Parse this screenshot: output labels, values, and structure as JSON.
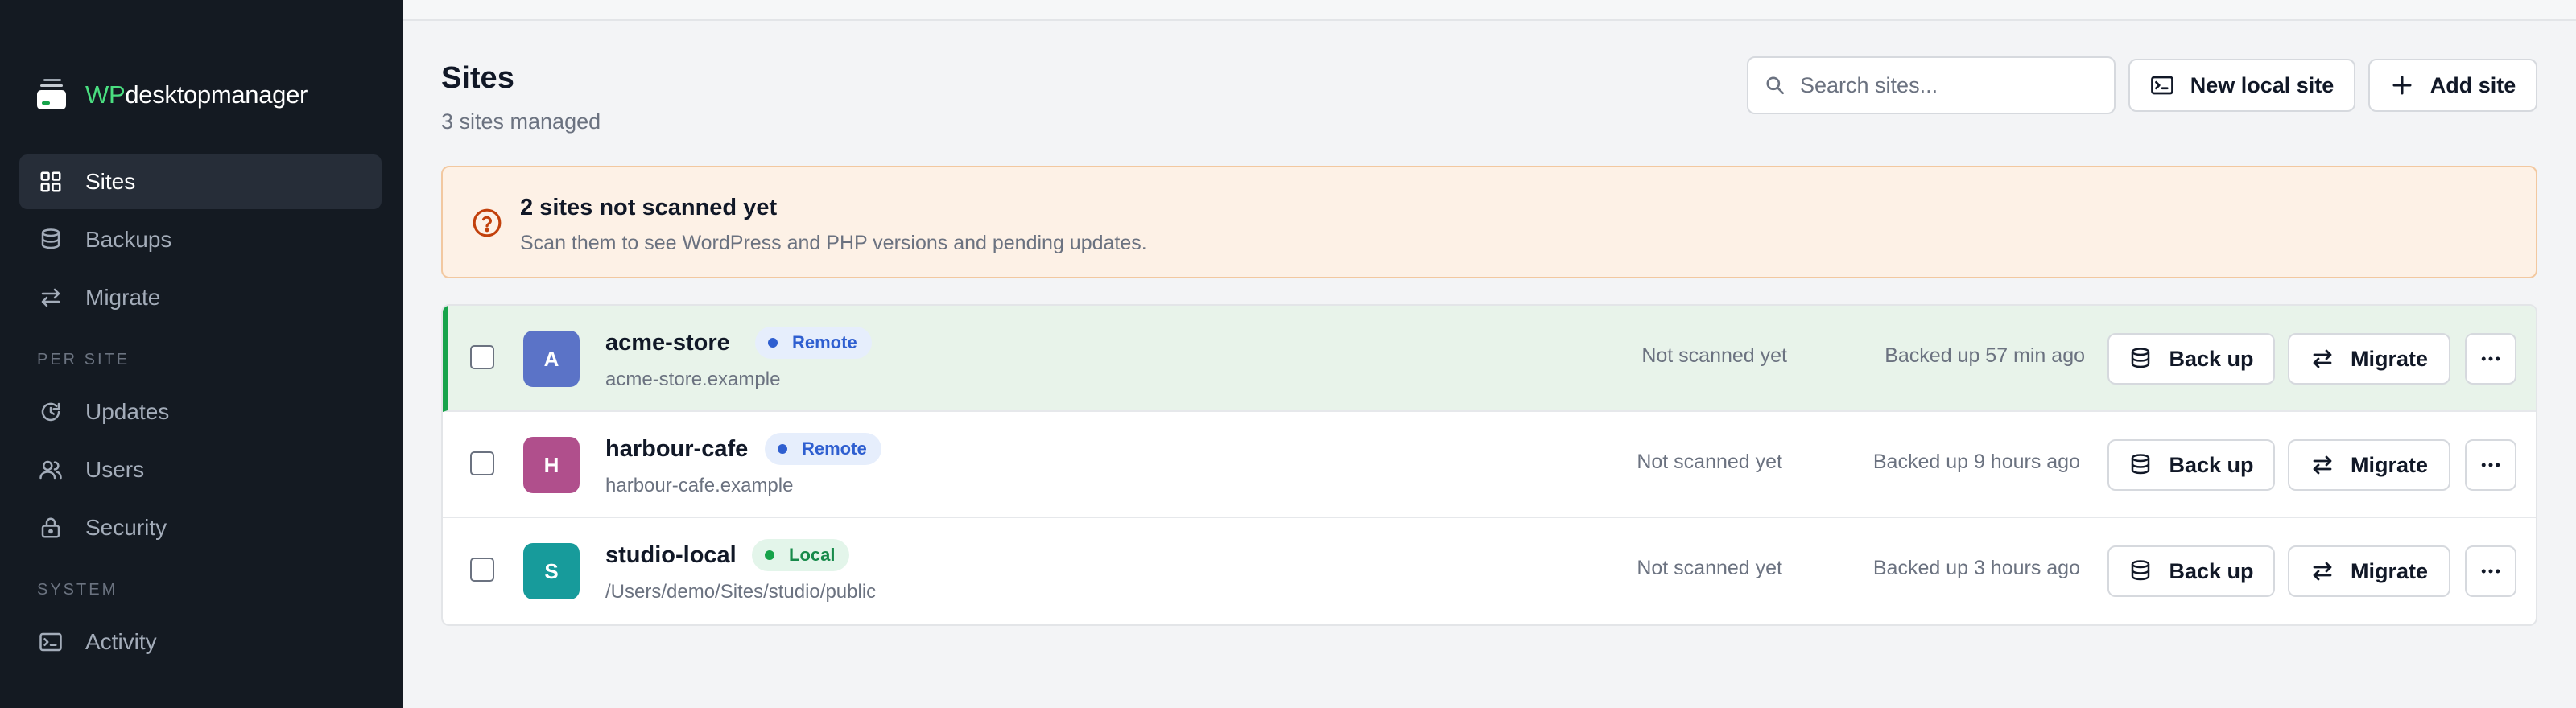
{
  "brand": {
    "prefix": "WP",
    "name": "desktopmanager"
  },
  "sidebar": {
    "items": [
      {
        "label": "Sites",
        "icon": "grid-icon",
        "active": true
      },
      {
        "label": "Backups",
        "icon": "database-icon"
      },
      {
        "label": "Migrate",
        "icon": "arrows-swap-icon"
      }
    ],
    "per_site_label": "PER SITE",
    "per_site_items": [
      {
        "label": "Updates",
        "icon": "refresh-clock-icon"
      },
      {
        "label": "Users",
        "icon": "users-icon"
      },
      {
        "label": "Security",
        "icon": "lock-icon"
      }
    ],
    "system_label": "SYSTEM",
    "system_items": [
      {
        "label": "Activity",
        "icon": "terminal-icon"
      }
    ]
  },
  "header": {
    "title": "Sites",
    "subtitle": "3 sites managed",
    "search_placeholder": "Search sites...",
    "new_local_label": "New local site",
    "add_site_label": "Add site"
  },
  "alert": {
    "title": "2 sites not scanned yet",
    "text": "Scan them to see WordPress and PHP versions and pending updates.",
    "icon": "question-circle-icon"
  },
  "sites": [
    {
      "initial": "A",
      "name": "acme-store",
      "badge": "Remote",
      "url": "acme-store.example",
      "scan": "Not scanned yet",
      "backup": "Backed up 57 min ago",
      "avatar_color": "#5b73c7",
      "highlighted": true
    },
    {
      "initial": "H",
      "name": "harbour-cafe",
      "badge": "Remote",
      "url": "harbour-cafe.example",
      "scan": "Not scanned yet",
      "backup": "Backed up 9 hours ago",
      "avatar_color": "#b04f8c",
      "highlighted": false
    },
    {
      "initial": "S",
      "name": "studio-local",
      "badge": "Local",
      "url": "/Users/demo/Sites/studio/public",
      "scan": "Not scanned yet",
      "backup": "Backed up 3 hours ago",
      "avatar_color": "#179b9b",
      "highlighted": false
    }
  ],
  "row_actions": {
    "backup_label": "Back up",
    "migrate_label": "Migrate"
  },
  "colors": {
    "accent_green": "#16a34a",
    "sidebar_bg": "#141a22",
    "alert_bg": "#fdf1e6",
    "alert_icon": "#c2410c"
  }
}
